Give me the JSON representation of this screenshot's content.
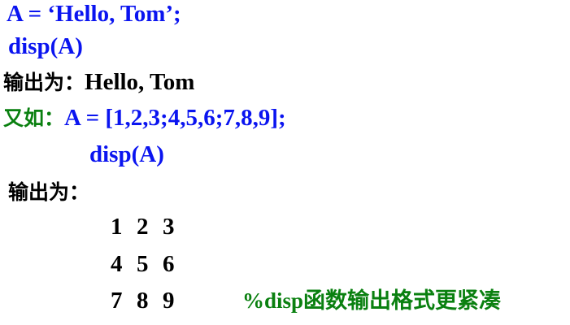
{
  "line1": "A = ‘Hello, Tom’;",
  "line2": "disp(A)",
  "line3_label": "输出为：",
  "line3_value": "Hello, Tom",
  "line4_label": "又如：",
  "line4_code": "A = [1,2,3;4,5,6;7,8,9];",
  "line5": "disp(A)",
  "line6_label": "输出为：",
  "matrix": [
    [
      "1",
      "2",
      "3"
    ],
    [
      "4",
      "5",
      "6"
    ],
    [
      "7",
      "8",
      "9"
    ]
  ],
  "comment": "%disp函数输出格式更紧凑",
  "colors": {
    "code": "#0a14f0",
    "label_green": "#0a8010",
    "text": "#000000"
  }
}
